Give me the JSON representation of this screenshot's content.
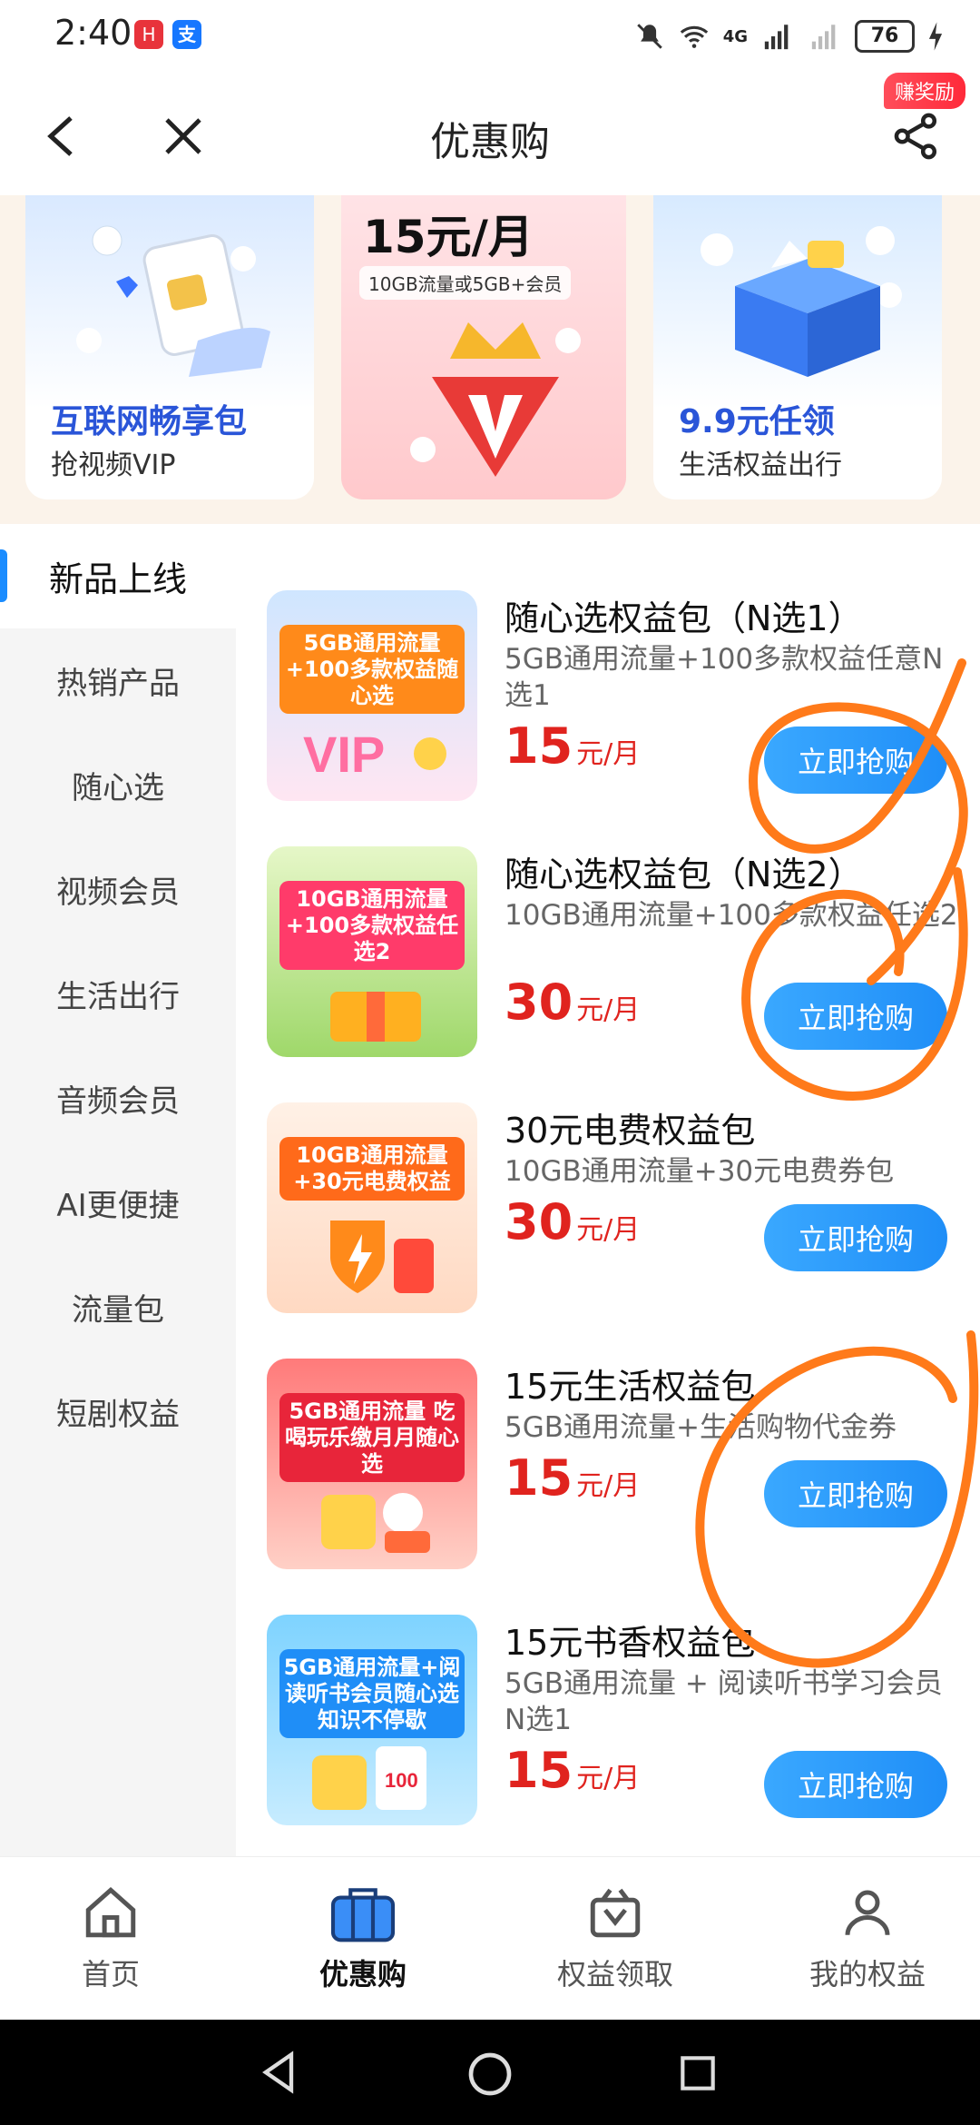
{
  "status_bar": {
    "time": "2:40",
    "battery": "76",
    "network": "4G"
  },
  "header": {
    "title": "优惠购",
    "reward_badge": "赚奖励",
    "back_icon": "chevron-left-icon",
    "close_icon": "close-icon",
    "share_icon": "share-icon"
  },
  "banner": {
    "cards": [
      {
        "title": "互联网畅享包",
        "subtitle": "抢视频VIP"
      },
      {
        "price": "15元/月",
        "note": "10GB流量或5GB+会员"
      },
      {
        "title": "9.9元任领",
        "subtitle": "生活权益出行"
      }
    ]
  },
  "sidebar": {
    "items": [
      {
        "label": "新品上线",
        "active": true
      },
      {
        "label": "热销产品",
        "active": false
      },
      {
        "label": "随心选",
        "active": false
      },
      {
        "label": "视频会员",
        "active": false
      },
      {
        "label": "生活出行",
        "active": false
      },
      {
        "label": "音频会员",
        "active": false
      },
      {
        "label": "AI更便捷",
        "active": false
      },
      {
        "label": "流量包",
        "active": false
      },
      {
        "label": "短剧权益",
        "active": false
      }
    ]
  },
  "products": [
    {
      "name": "随心选权益包（N选1）",
      "desc": "5GB通用流量+100多款权益任意N选1",
      "price": "15",
      "unit": "元/月",
      "button": "立即抢购",
      "thumb_text": "5GB通用流量+100多款权益随心选"
    },
    {
      "name": "随心选权益包（N选2）",
      "desc": "10GB通用流量+100多款权益任选2",
      "price": "30",
      "unit": "元/月",
      "button": "立即抢购",
      "thumb_text": "10GB通用流量+100多款权益任选2"
    },
    {
      "name": "30元电费权益包",
      "desc": "10GB通用流量+30元电费券包",
      "price": "30",
      "unit": "元/月",
      "button": "立即抢购",
      "thumb_text": "10GB通用流量 +30元电费权益"
    },
    {
      "name": "15元生活权益包",
      "desc": "5GB通用流量+生活购物代金券",
      "price": "15",
      "unit": "元/月",
      "button": "立即抢购",
      "thumb_text": "5GB通用流量 吃喝玩乐缴月月随心选"
    },
    {
      "name": "15元书香权益包",
      "desc": "5GB通用流量 + 阅读听书学习会员N选1",
      "price": "15",
      "unit": "元/月",
      "button": "立即抢购",
      "thumb_text": "5GB通用流量+阅读听书会员随心选 知识不停歇"
    }
  ],
  "bottom_nav": {
    "items": [
      {
        "label": "首页",
        "icon": "home-icon",
        "active": false
      },
      {
        "label": "优惠购",
        "icon": "shopping-bag-icon",
        "active": true
      },
      {
        "label": "权益领取",
        "icon": "gift-box-icon",
        "active": false
      },
      {
        "label": "我的权益",
        "icon": "user-icon",
        "active": false
      }
    ]
  },
  "colors": {
    "accent": "#1f8ef7",
    "price": "#e0231e",
    "scribble": "#ff7a1a",
    "sidebar_bg": "#f5f5f5"
  }
}
